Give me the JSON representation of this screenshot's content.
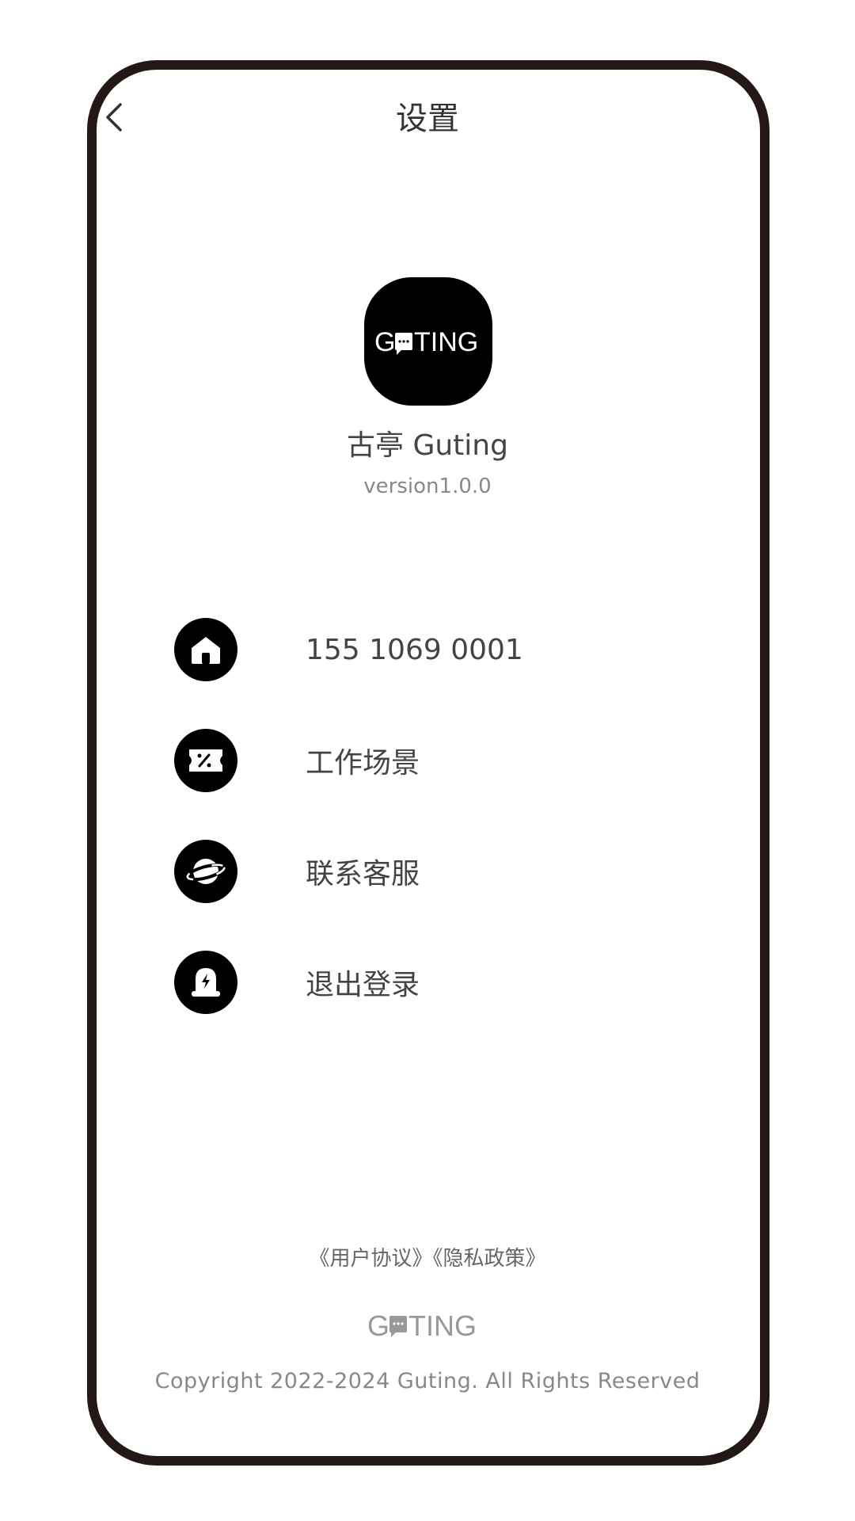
{
  "header": {
    "title": "设置"
  },
  "app": {
    "logo_text": "GUTING",
    "name": "古亭 Guting",
    "version": "version1.0.0"
  },
  "menu": {
    "items": [
      {
        "label": "155 1069 0001",
        "icon": "home-icon"
      },
      {
        "label": "工作场景",
        "icon": "ticket-icon"
      },
      {
        "label": "联系客服",
        "icon": "planet-icon"
      },
      {
        "label": "退出登录",
        "icon": "tombstone-lightning-icon"
      }
    ]
  },
  "footer": {
    "user_agreement": "《用户协议》",
    "privacy_policy": "《隐私政策》",
    "copyright": "Copyright 2022-2024 Guting. All Rights Reserved"
  },
  "colors": {
    "frame": "#231815",
    "icon_bg": "#000000",
    "text_primary": "#333333",
    "text_secondary": "#888888"
  }
}
